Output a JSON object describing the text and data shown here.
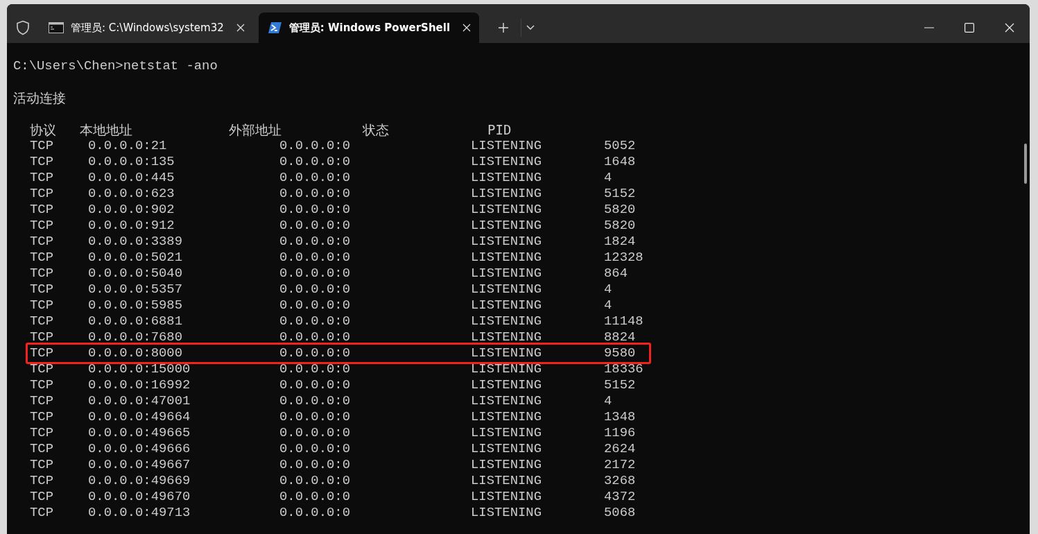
{
  "tabs": [
    {
      "title": "管理员: C:\\Windows\\system32",
      "kind": "cmd",
      "selected": false
    },
    {
      "title": "管理员: Windows PowerShell",
      "kind": "powershell",
      "selected": true
    }
  ],
  "terminal": {
    "prompt": "C:\\Users\\Chen>netstat -ano",
    "heading": "活动连接",
    "columns": [
      "协议",
      "本地地址",
      "外部地址",
      "状态",
      "PID"
    ],
    "rows": [
      {
        "protocol": "TCP",
        "local": "0.0.0.0:21",
        "foreign": "0.0.0.0:0",
        "state": "LISTENING",
        "pid": "5052",
        "highlighted": false
      },
      {
        "protocol": "TCP",
        "local": "0.0.0.0:135",
        "foreign": "0.0.0.0:0",
        "state": "LISTENING",
        "pid": "1648",
        "highlighted": false
      },
      {
        "protocol": "TCP",
        "local": "0.0.0.0:445",
        "foreign": "0.0.0.0:0",
        "state": "LISTENING",
        "pid": "4",
        "highlighted": false
      },
      {
        "protocol": "TCP",
        "local": "0.0.0.0:623",
        "foreign": "0.0.0.0:0",
        "state": "LISTENING",
        "pid": "5152",
        "highlighted": false
      },
      {
        "protocol": "TCP",
        "local": "0.0.0.0:902",
        "foreign": "0.0.0.0:0",
        "state": "LISTENING",
        "pid": "5820",
        "highlighted": false
      },
      {
        "protocol": "TCP",
        "local": "0.0.0.0:912",
        "foreign": "0.0.0.0:0",
        "state": "LISTENING",
        "pid": "5820",
        "highlighted": false
      },
      {
        "protocol": "TCP",
        "local": "0.0.0.0:3389",
        "foreign": "0.0.0.0:0",
        "state": "LISTENING",
        "pid": "1824",
        "highlighted": false
      },
      {
        "protocol": "TCP",
        "local": "0.0.0.0:5021",
        "foreign": "0.0.0.0:0",
        "state": "LISTENING",
        "pid": "12328",
        "highlighted": false
      },
      {
        "protocol": "TCP",
        "local": "0.0.0.0:5040",
        "foreign": "0.0.0.0:0",
        "state": "LISTENING",
        "pid": "864",
        "highlighted": false
      },
      {
        "protocol": "TCP",
        "local": "0.0.0.0:5357",
        "foreign": "0.0.0.0:0",
        "state": "LISTENING",
        "pid": "4",
        "highlighted": false
      },
      {
        "protocol": "TCP",
        "local": "0.0.0.0:5985",
        "foreign": "0.0.0.0:0",
        "state": "LISTENING",
        "pid": "4",
        "highlighted": false
      },
      {
        "protocol": "TCP",
        "local": "0.0.0.0:6881",
        "foreign": "0.0.0.0:0",
        "state": "LISTENING",
        "pid": "11148",
        "highlighted": false
      },
      {
        "protocol": "TCP",
        "local": "0.0.0.0:7680",
        "foreign": "0.0.0.0:0",
        "state": "LISTENING",
        "pid": "8824",
        "highlighted": false
      },
      {
        "protocol": "TCP",
        "local": "0.0.0.0:8000",
        "foreign": "0.0.0.0:0",
        "state": "LISTENING",
        "pid": "9580",
        "highlighted": true
      },
      {
        "protocol": "TCP",
        "local": "0.0.0.0:15000",
        "foreign": "0.0.0.0:0",
        "state": "LISTENING",
        "pid": "18336",
        "highlighted": false
      },
      {
        "protocol": "TCP",
        "local": "0.0.0.0:16992",
        "foreign": "0.0.0.0:0",
        "state": "LISTENING",
        "pid": "5152",
        "highlighted": false
      },
      {
        "protocol": "TCP",
        "local": "0.0.0.0:47001",
        "foreign": "0.0.0.0:0",
        "state": "LISTENING",
        "pid": "4",
        "highlighted": false
      },
      {
        "protocol": "TCP",
        "local": "0.0.0.0:49664",
        "foreign": "0.0.0.0:0",
        "state": "LISTENING",
        "pid": "1348",
        "highlighted": false
      },
      {
        "protocol": "TCP",
        "local": "0.0.0.0:49665",
        "foreign": "0.0.0.0:0",
        "state": "LISTENING",
        "pid": "1196",
        "highlighted": false
      },
      {
        "protocol": "TCP",
        "local": "0.0.0.0:49666",
        "foreign": "0.0.0.0:0",
        "state": "LISTENING",
        "pid": "2624",
        "highlighted": false
      },
      {
        "protocol": "TCP",
        "local": "0.0.0.0:49667",
        "foreign": "0.0.0.0:0",
        "state": "LISTENING",
        "pid": "2172",
        "highlighted": false
      },
      {
        "protocol": "TCP",
        "local": "0.0.0.0:49669",
        "foreign": "0.0.0.0:0",
        "state": "LISTENING",
        "pid": "3268",
        "highlighted": false
      },
      {
        "protocol": "TCP",
        "local": "0.0.0.0:49670",
        "foreign": "0.0.0.0:0",
        "state": "LISTENING",
        "pid": "4372",
        "highlighted": false
      },
      {
        "protocol": "TCP",
        "local": "0.0.0.0:49713",
        "foreign": "0.0.0.0:0",
        "state": "LISTENING",
        "pid": "5068",
        "highlighted": false
      }
    ]
  }
}
